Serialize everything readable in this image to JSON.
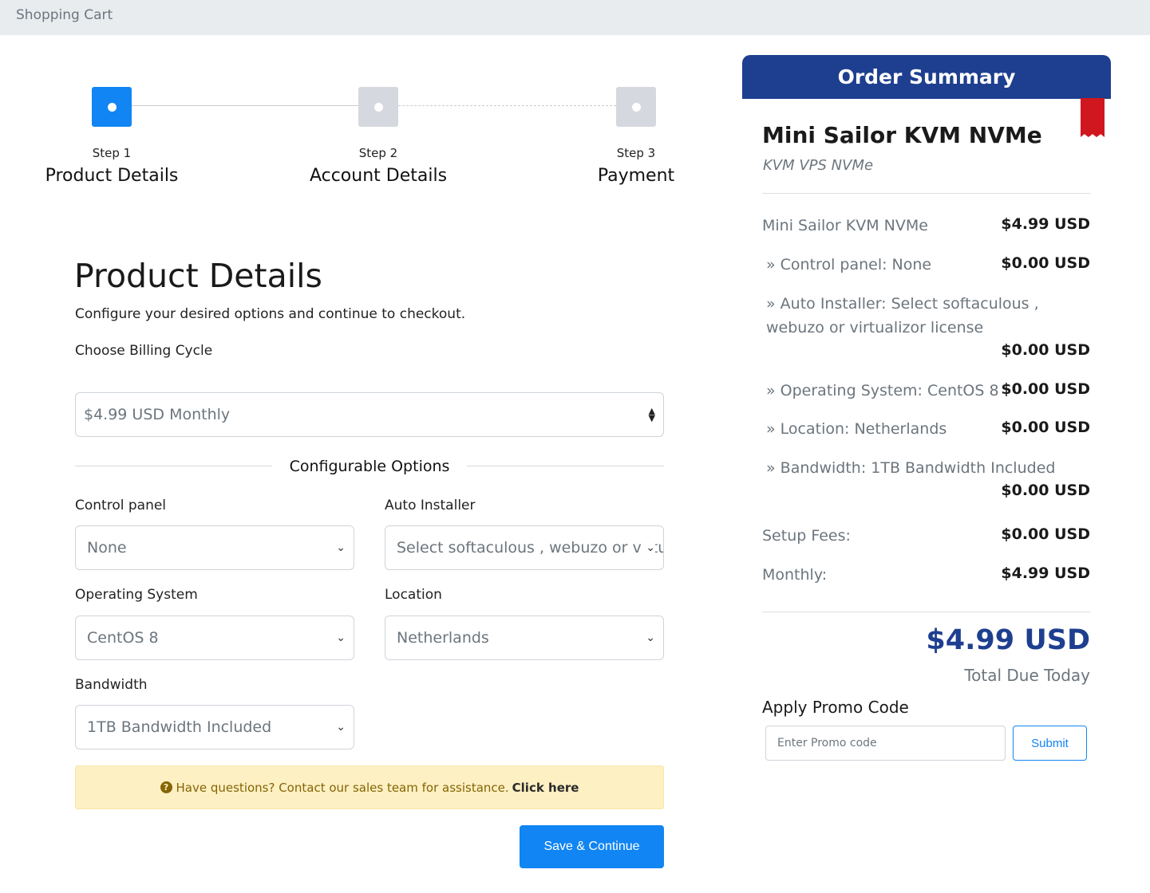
{
  "header": {
    "title": "Shopping Cart"
  },
  "steps": [
    {
      "num": "Step 1",
      "title": "Product Details",
      "state": "active"
    },
    {
      "num": "Step 2",
      "title": "Account Details",
      "state": "pending"
    },
    {
      "num": "Step 3",
      "title": "Payment",
      "state": "pending"
    }
  ],
  "main": {
    "title": "Product Details",
    "subtitle": "Configure your desired options and continue to checkout.",
    "billing_label": "Choose Billing Cycle",
    "billing_value": "$4.99 USD Monthly",
    "config_title": "Configurable Options",
    "options": {
      "control_panel": {
        "label": "Control panel",
        "value": "None"
      },
      "auto_installer": {
        "label": "Auto Installer",
        "value": "Select softaculous , webuzo or virtualizor license"
      },
      "os": {
        "label": "Operating System",
        "value": "CentOS 8"
      },
      "location": {
        "label": "Location",
        "value": "Netherlands"
      },
      "bandwidth": {
        "label": "Bandwidth",
        "value": "1TB Bandwidth Included"
      }
    },
    "alert": {
      "text": "Have questions? Contact our sales team for assistance.",
      "link": "Click here"
    },
    "save_button": "Save & Continue"
  },
  "summary": {
    "heading": "Order Summary",
    "product_name": "Mini Sailor KVM NVMe",
    "product_group": "KVM VPS NVMe",
    "items": [
      {
        "label": "Mini Sailor KVM NVMe",
        "price": "$4.99 USD"
      },
      {
        "label": "» Control panel: None",
        "price": "$0.00 USD"
      },
      {
        "label": "» Auto Installer: Select softaculous , webuzo or virtualizor license",
        "price": "$0.00 USD"
      },
      {
        "label": "» Operating System: CentOS 8",
        "price": "$0.00 USD"
      },
      {
        "label": "» Location: Netherlands",
        "price": "$0.00 USD"
      },
      {
        "label": "» Bandwidth: 1TB Bandwidth Included",
        "price": "$0.00 USD"
      }
    ],
    "setup_label": "Setup Fees:",
    "setup_price": "$0.00 USD",
    "monthly_label": "Monthly:",
    "monthly_price": "$4.99 USD",
    "total": "$4.99 USD",
    "total_label": "Total Due Today",
    "promo_label": "Apply Promo Code",
    "promo_placeholder": "Enter Promo code",
    "promo_button": "Submit"
  },
  "colors": {
    "accent": "#1185f3",
    "summary_header": "#1e3f8f",
    "ribbon": "#d0161f",
    "alert_bg": "#fdf0c3"
  }
}
